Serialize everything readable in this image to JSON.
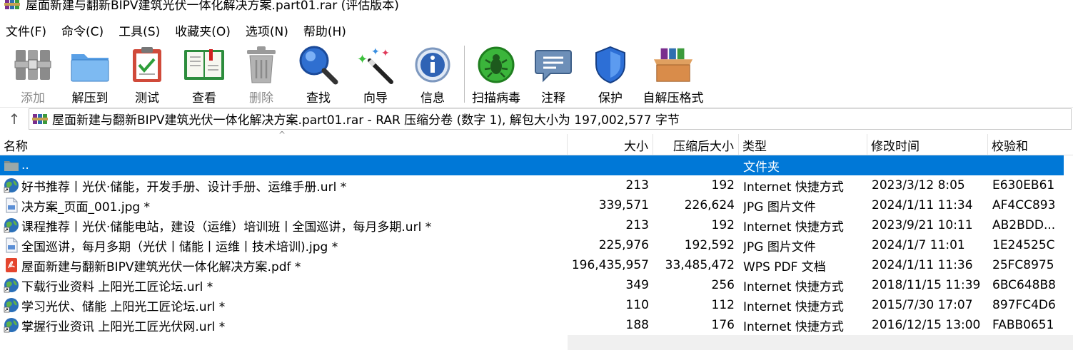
{
  "window": {
    "title": "屋面新建与翻新BIPV建筑光伏一体化解决方案.part01.rar (评估版本)"
  },
  "menu": [
    {
      "label": "文件(F)"
    },
    {
      "label": "命令(C)"
    },
    {
      "label": "工具(S)"
    },
    {
      "label": "收藏夹(O)"
    },
    {
      "label": "选项(N)"
    },
    {
      "label": "帮助(H)"
    }
  ],
  "toolbar": {
    "add": "添加",
    "extract": "解压到",
    "test": "测试",
    "view": "查看",
    "delete": "删除",
    "find": "查找",
    "wizard": "向导",
    "info": "信息",
    "virus_scan": "扫描病毒",
    "comment": "注释",
    "protect": "保护",
    "sfx": "自解压格式"
  },
  "address": {
    "path_text": "屋面新建与翻新BIPV建筑光伏一体化解决方案.part01.rar - RAR 压缩分卷 (数字 1), 解包大小为 197,002,577 字节"
  },
  "columns": {
    "name": "名称",
    "size": "大小",
    "packed": "压缩后大小",
    "type": "类型",
    "modified": "修改时间",
    "crc": "校验和"
  },
  "files": [
    {
      "name": "..",
      "size": "",
      "packed": "",
      "type": "文件夹",
      "modified": "",
      "crc": "",
      "icon": "folder-icon"
    },
    {
      "name": "好书推荐丨光伏·储能，开发手册、设计手册、运维手册.url *",
      "size": "213",
      "packed": "192",
      "type": "Internet 快捷方式",
      "modified": "2023/3/12 8:05",
      "crc": "E630EB61",
      "icon": "internet-shortcut-icon"
    },
    {
      "name": "决方案_页面_001.jpg *",
      "size": "339,571",
      "packed": "226,624",
      "type": "JPG 图片文件",
      "modified": "2024/1/11 11:34",
      "crc": "AF4CC893",
      "icon": "jpg-file-icon"
    },
    {
      "name": "课程推荐丨光伏·储能电站，建设（运维）培训班丨全国巡讲，每月多期.url *",
      "size": "213",
      "packed": "192",
      "type": "Internet 快捷方式",
      "modified": "2023/9/21 10:11",
      "crc": "AB2BDD...",
      "icon": "internet-shortcut-icon"
    },
    {
      "name": "全国巡讲，每月多期（光伏丨储能丨运维丨技术培训).jpg *",
      "size": "225,976",
      "packed": "192,592",
      "type": "JPG 图片文件",
      "modified": "2024/1/7 11:01",
      "crc": "1E24525C",
      "icon": "jpg-file-icon"
    },
    {
      "name": "屋面新建与翻新BIPV建筑光伏一体化解决方案.pdf *",
      "size": "196,435,957",
      "packed": "33,485,472",
      "type": "WPS PDF 文档",
      "modified": "2024/1/11 11:36",
      "crc": "25FC8975",
      "icon": "pdf-file-icon"
    },
    {
      "name": "下载行业资料 上阳光工匠论坛.url *",
      "size": "349",
      "packed": "256",
      "type": "Internet 快捷方式",
      "modified": "2018/11/15 11:39",
      "crc": "6BC648B8",
      "icon": "internet-shortcut-icon"
    },
    {
      "name": "学习光伏、储能 上阳光工匠论坛.url *",
      "size": "110",
      "packed": "112",
      "type": "Internet 快捷方式",
      "modified": "2015/7/30 17:07",
      "crc": "897FC4D6",
      "icon": "internet-shortcut-icon"
    },
    {
      "name": "掌握行业资讯 上阳光工匠光伏网.url *",
      "size": "188",
      "packed": "176",
      "type": "Internet 快捷方式",
      "modified": "2016/12/15 13:00",
      "crc": "FABB0651",
      "icon": "internet-shortcut-icon"
    }
  ],
  "colors": {
    "selection": "#0078d7",
    "disabled_text": "#8a8a8a"
  }
}
